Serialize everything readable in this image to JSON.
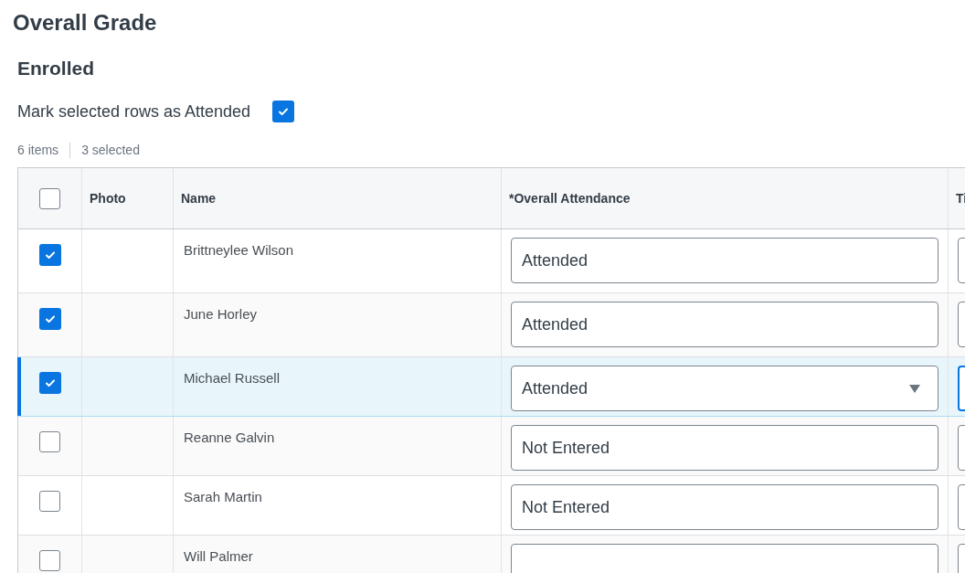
{
  "page_title": "Overall Grade",
  "section_title": "Enrolled",
  "mark_selected": {
    "label": "Mark selected rows as Attended",
    "checked": true
  },
  "summary": {
    "items": "6 items",
    "selected": "3 selected"
  },
  "table": {
    "select_all_checked": false,
    "columns": [
      "Photo",
      "Name",
      "*Overall Attendance",
      "Ti"
    ],
    "rows": [
      {
        "name": "Brittneylee Wilson",
        "checked": true,
        "focused": false,
        "attendance": "Attended"
      },
      {
        "name": "June Horley",
        "checked": true,
        "focused": false,
        "attendance": "Attended"
      },
      {
        "name": "Michael Russell",
        "checked": true,
        "focused": true,
        "attendance": "Attended"
      },
      {
        "name": "Reanne Galvin",
        "checked": false,
        "focused": false,
        "attendance": "Not Entered"
      },
      {
        "name": "Sarah Martin",
        "checked": false,
        "focused": false,
        "attendance": "Not Entered"
      },
      {
        "name": "Will Palmer",
        "checked": false,
        "focused": false
      }
    ]
  }
}
